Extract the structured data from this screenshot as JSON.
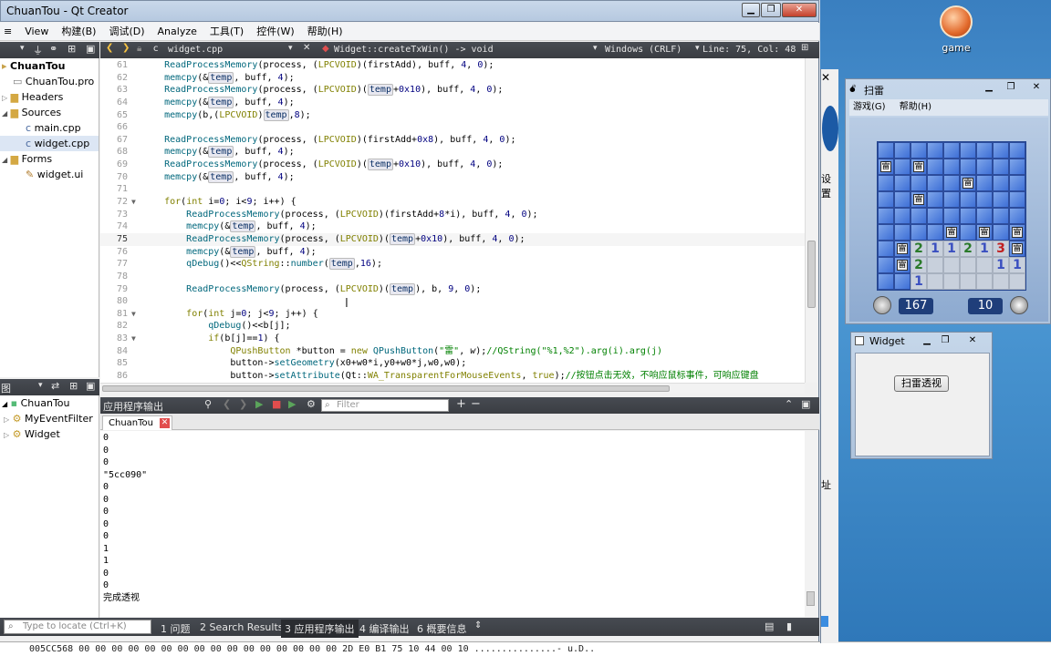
{
  "qt": {
    "title": "ChuanTou - Qt Creator",
    "menu": [
      "View",
      "构建(B)",
      "调试(D)",
      "Analyze",
      "工具(T)",
      "控件(W)",
      "帮助(H)"
    ],
    "file_tab": "widget.cpp",
    "func_combo": "Widget::createTxWin() -> void",
    "line_ending": "Windows (CRLF)",
    "position": "Line: 75, Col: 48",
    "project_tree": [
      {
        "label": "ChuanTou",
        "depth": 0,
        "bold": true
      },
      {
        "label": "ChuanTou.pro",
        "depth": 1
      },
      {
        "label": "Headers",
        "depth": 1
      },
      {
        "label": "Sources",
        "depth": 1
      },
      {
        "label": "main.cpp",
        "depth": 2
      },
      {
        "label": "widget.cpp",
        "depth": 2
      },
      {
        "label": "Forms",
        "depth": 1
      },
      {
        "label": "widget.ui",
        "depth": 2
      }
    ],
    "lower_panel_title": "图",
    "class_tree": [
      {
        "label": "ChuanTou",
        "depth": 0
      },
      {
        "label": "MyEventFilter",
        "depth": 1
      },
      {
        "label": "Widget",
        "depth": 1
      }
    ],
    "output_title": "应用程序输出",
    "filter_placeholder": "Filter",
    "output_tab": "ChuanTou",
    "output_lines": [
      "0",
      "0",
      "0",
      "\"5cc090\"",
      "0",
      "0",
      "0",
      "0",
      "0",
      "1",
      "1",
      "0",
      "0",
      "完成透视"
    ],
    "locator_placeholder": "Type to locate (Ctrl+K)",
    "status_tabs": [
      "1 问题",
      "2 Search Results",
      "3 应用程序输出",
      "4 编译输出",
      "6 概要信息"
    ],
    "hex_row": "005CC568 00 00 00 00 00 00 00 00 00 00 00 00 00 00 00 00 2D E0 B1 75 10 44 00 10 ...............-  u.D.."
  },
  "code_lines": [
    {
      "n": "61",
      "html": "    <span class=\"fn\">ReadProcessMemory</span>(process, (<span class=\"kw\">LPCVOID</span>)(firstAdd), buff, <span class=\"nm\">4</span>, <span class=\"nm\">0</span>);"
    },
    {
      "n": "62",
      "html": "    <span class=\"fn\">memcpy</span>(&amp;<span class=\"vr\">temp</span>, buff, <span class=\"nm\">4</span>);"
    },
    {
      "n": "63",
      "html": "    <span class=\"fn\">ReadProcessMemory</span>(process, (<span class=\"kw\">LPCVOID</span>)(<span class=\"vr\">temp</span>+<span class=\"nm\">0x10</span>), buff, <span class=\"nm\">4</span>, <span class=\"nm\">0</span>);"
    },
    {
      "n": "64",
      "html": "    <span class=\"fn\">memcpy</span>(&amp;<span class=\"vr\">temp</span>, buff, <span class=\"nm\">4</span>);"
    },
    {
      "n": "65",
      "html": "    <span class=\"fn\">memcpy</span>(b,(<span class=\"kw\">LPCVOID</span>)<span class=\"vr\">temp</span>,<span class=\"nm\">8</span>);"
    },
    {
      "n": "66",
      "html": ""
    },
    {
      "n": "67",
      "html": "    <span class=\"fn\">ReadProcessMemory</span>(process, (<span class=\"kw\">LPCVOID</span>)(firstAdd+<span class=\"nm\">0x8</span>), buff, <span class=\"nm\">4</span>, <span class=\"nm\">0</span>);"
    },
    {
      "n": "68",
      "html": "    <span class=\"fn\">memcpy</span>(&amp;<span class=\"vr\">temp</span>, buff, <span class=\"nm\">4</span>);"
    },
    {
      "n": "69",
      "html": "    <span class=\"fn\">ReadProcessMemory</span>(process, (<span class=\"kw\">LPCVOID</span>)(<span class=\"vr\">temp</span>+<span class=\"nm\">0x10</span>), buff, <span class=\"nm\">4</span>, <span class=\"nm\">0</span>);"
    },
    {
      "n": "70",
      "html": "    <span class=\"fn\">memcpy</span>(&amp;<span class=\"vr\">temp</span>, buff, <span class=\"nm\">4</span>);"
    },
    {
      "n": "71",
      "html": ""
    },
    {
      "n": "72",
      "html": "    <span class=\"kw\">for</span>(<span class=\"kw\">int</span> i=<span class=\"nm\">0</span>; i&lt;<span class=\"nm\">9</span>; i++) {"
    },
    {
      "n": "73",
      "html": "        <span class=\"fn\">ReadProcessMemory</span>(process, (<span class=\"kw\">LPCVOID</span>)(firstAdd+<span class=\"nm\">8</span>*i), buff, <span class=\"nm\">4</span>, <span class=\"nm\">0</span>);"
    },
    {
      "n": "74",
      "html": "        <span class=\"fn\">memcpy</span>(&amp;<span class=\"vr\">temp</span>, buff, <span class=\"nm\">4</span>);"
    },
    {
      "n": "75",
      "html": "        <span class=\"fn\">ReadProcessMemory</span>(process, (<span class=\"kw\">LPCVOID</span>)(<span class=\"vr\">temp</span>+<span class=\"nm\">0x10</span>), buff, <span class=\"nm\">4</span>, <span class=\"nm\">0</span>);"
    },
    {
      "n": "76",
      "html": "        <span class=\"fn\">memcpy</span>(&amp;<span class=\"vr\">temp</span>, buff, <span class=\"nm\">4</span>);"
    },
    {
      "n": "77",
      "html": "        <span class=\"fn\">qDebug</span>()&lt;&lt;<span class=\"kw\">QString</span>::<span class=\"fn\">number</span>(<span class=\"vr\">temp</span>,<span class=\"nm\">16</span>);"
    },
    {
      "n": "78",
      "html": ""
    },
    {
      "n": "79",
      "html": "        <span class=\"fn\">ReadProcessMemory</span>(process, (<span class=\"kw\">LPCVOID</span>)(<span class=\"vr\">temp</span>), b, <span class=\"nm\">9</span>, <span class=\"nm\">0</span>);"
    },
    {
      "n": "80",
      "html": ""
    },
    {
      "n": "81",
      "html": "        <span class=\"kw\">for</span>(<span class=\"kw\">int</span> j=<span class=\"nm\">0</span>; j&lt;<span class=\"nm\">9</span>; j++) {"
    },
    {
      "n": "82",
      "html": "            <span class=\"fn\">qDebug</span>()&lt;&lt;b[j];"
    },
    {
      "n": "83",
      "html": "            <span class=\"kw\">if</span>(b[j]==<span class=\"nm\">1</span>) {"
    },
    {
      "n": "84",
      "html": "                <span class=\"kw\">QPushButton</span> *button = <span class=\"kw\">new</span> <span class=\"fn\">QPushButton</span>(<span class=\"st\">\"雷\"</span>, <i>w</i>);<span class=\"cm\">//QString(\"%1,%2\").arg(i).arg(j)</span>"
    },
    {
      "n": "85",
      "html": "                button-&gt;<span class=\"fn\">setGeometry</span>(x0+w0*i,y0+w0*j,w0,w0);"
    },
    {
      "n": "86",
      "html": "                button-&gt;<span class=\"fn\">setAttribute</span>(Qt::<span class=\"kw\">WA_TransparentForMouseEvents</span>, <span class=\"kw\">true</span>);<span class=\"cm\">//按钮点击无效，不响应鼠标事件，可响应键盘</span>"
    }
  ],
  "mine": {
    "title": "扫雷",
    "menu": [
      "游戏(G)",
      "帮助(H)"
    ],
    "time": "167",
    "mines_left": "10",
    "grid": [
      "#########",
      "M#M######",
      "#####M###",
      "##M######",
      "#########",
      "####M#M#M",
      "#M211213M",
      "#M2....11",
      "##1......"
    ]
  },
  "widget_win": {
    "title": "Widget",
    "button": "扫雷透视"
  },
  "desktop": {
    "icon_label": "game",
    "side_text": "设置",
    "side_text2": "址"
  }
}
